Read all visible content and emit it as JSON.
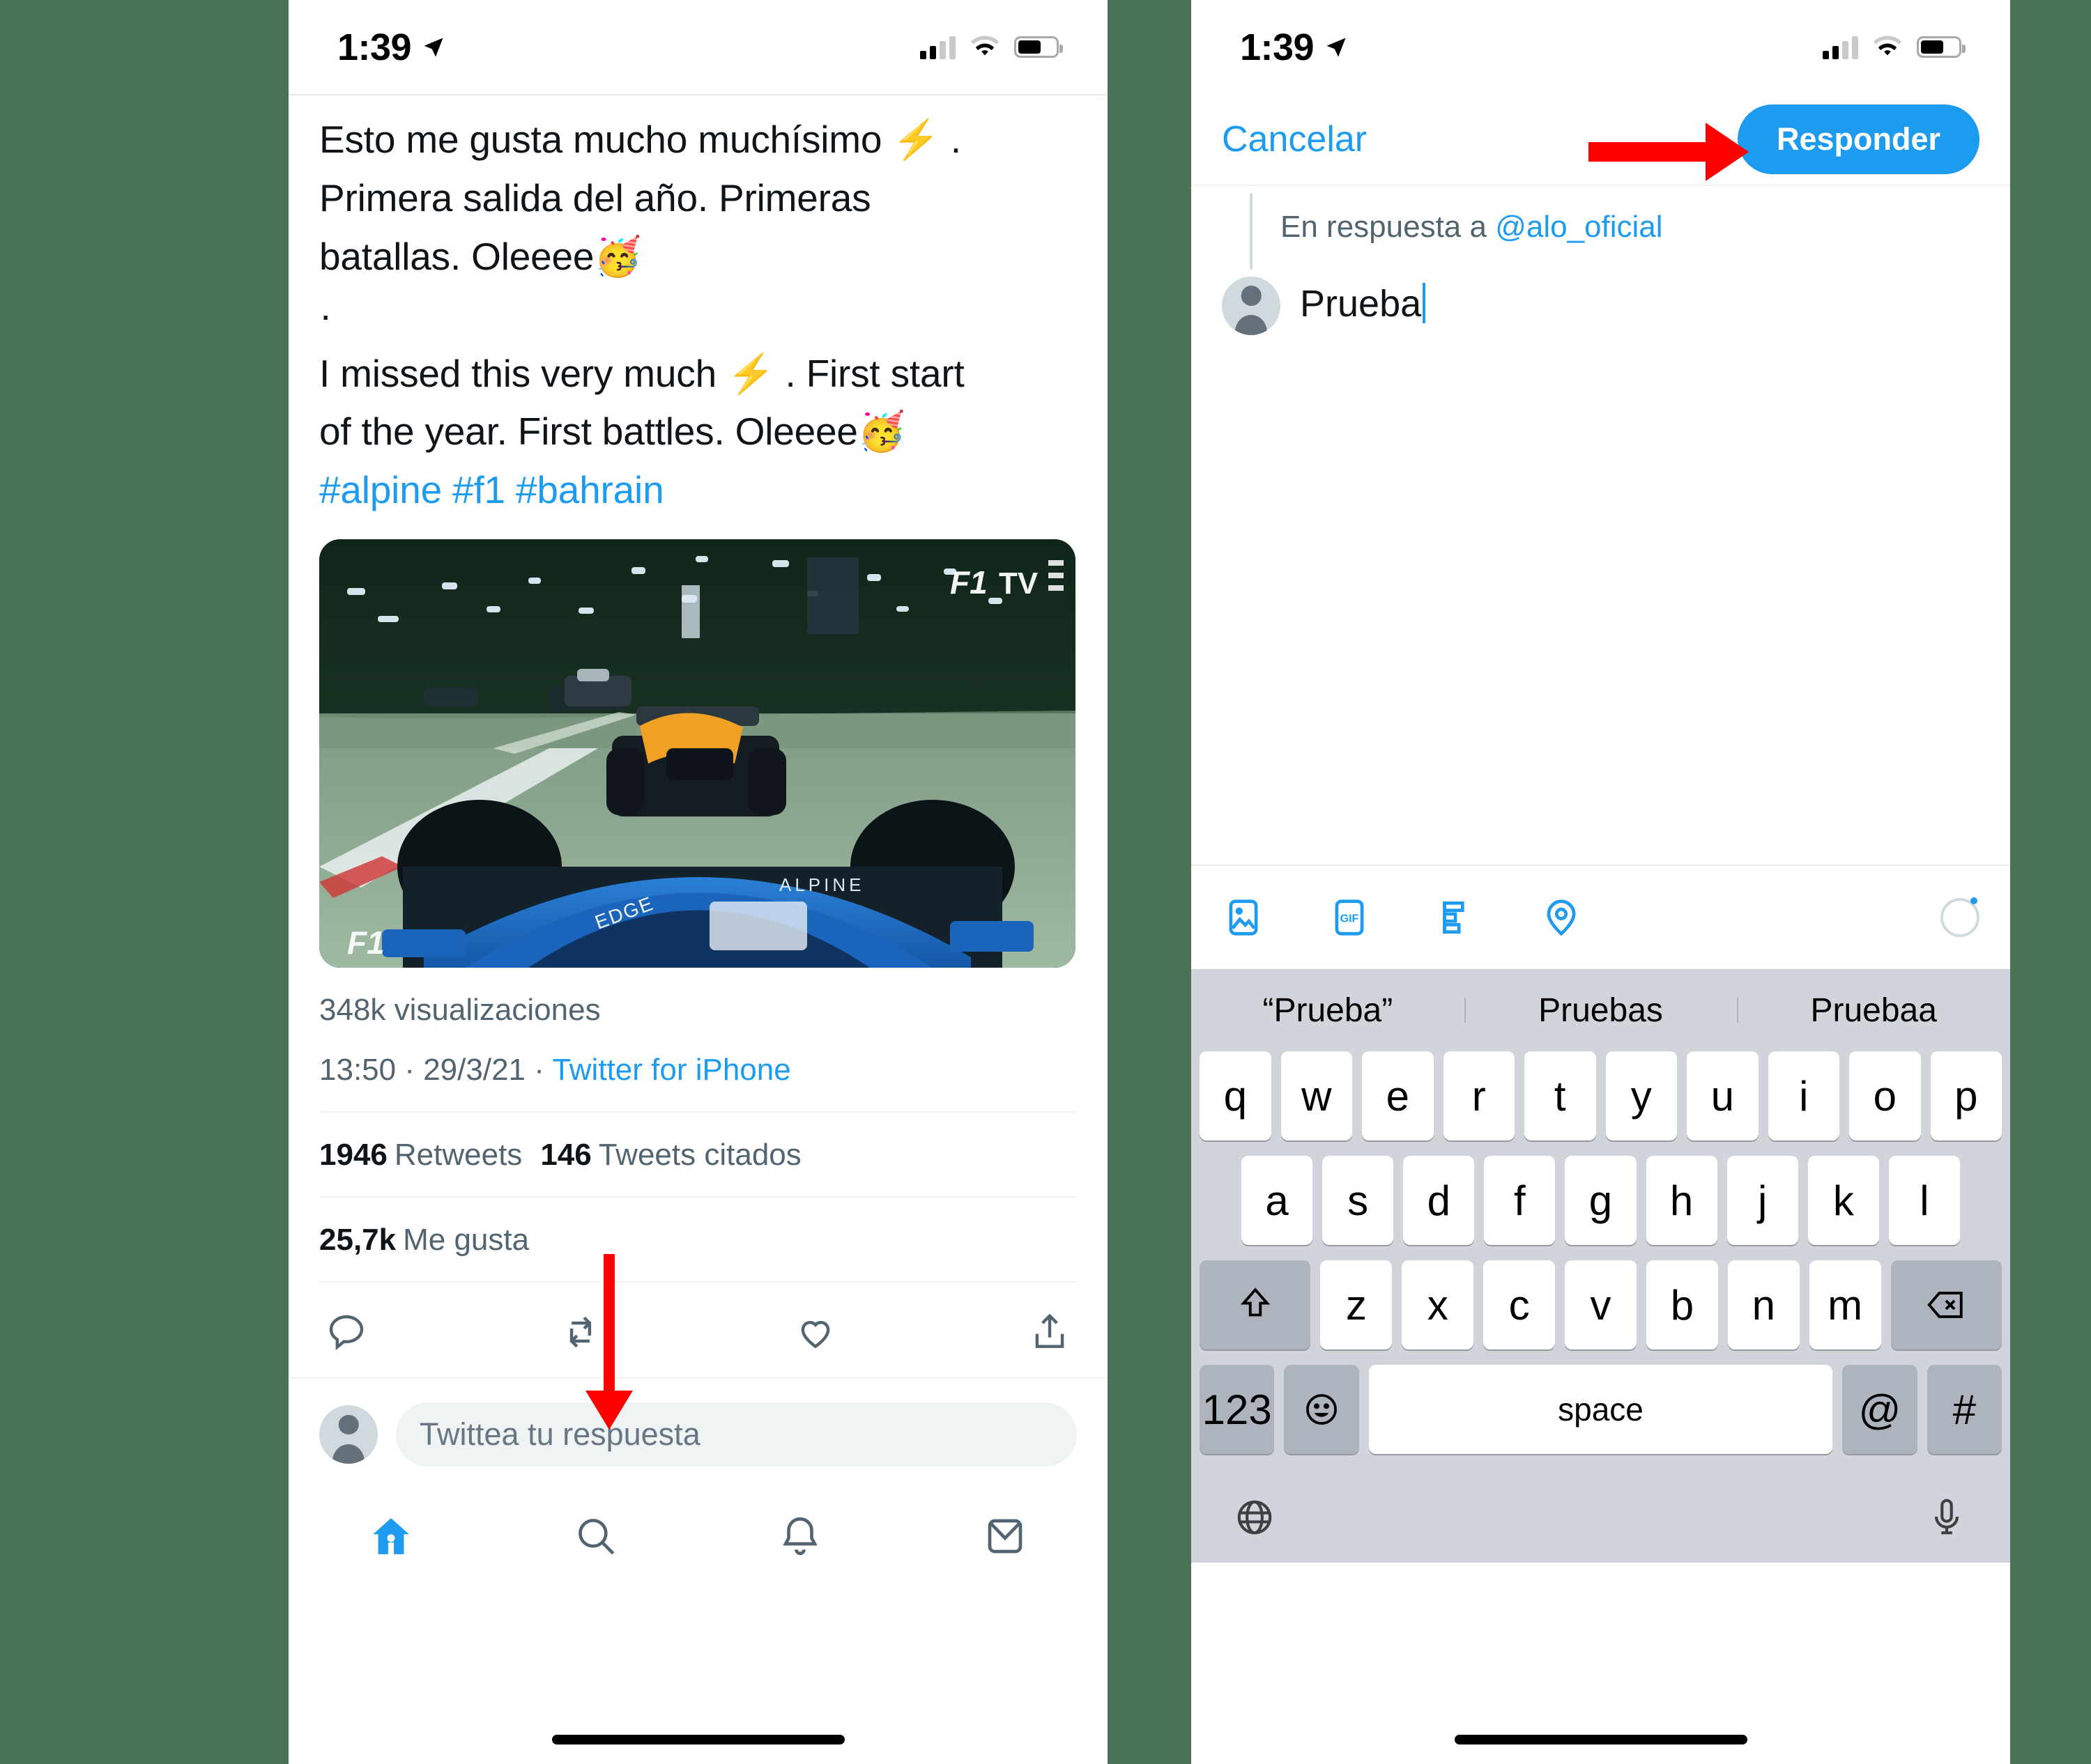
{
  "background_color": "#4a7355",
  "accent_color": "#1d9bf0",
  "annotation_color": "#ff0000",
  "status_bar": {
    "time": "1:39",
    "location_icon": "location-arrow-icon",
    "signal_icon": "cellular-signal-icon",
    "wifi_icon": "wifi-icon",
    "battery_icon": "battery-icon",
    "battery_level_percent": 62
  },
  "left_screen": {
    "tweet": {
      "text_line_1": "Esto me gusta mucho muchísimo ⚡️ .",
      "text_line_2": "Primera salida del año. Primeras",
      "text_line_3": "batallas. Oleeee🥳",
      "separator": "·",
      "text_line_4": "I missed this very much ⚡️ .  First start",
      "text_line_5": "of the year.  First battles.  Oleeee🥳",
      "hashtags": "#alpine #f1 #bahrain",
      "media_label": "f1-onboard-video-thumbnail",
      "media_badge": "F1 TV",
      "views": "348k visualizaciones",
      "timestamp": "13:50 · 29/3/21 · ",
      "source": "Twitter for iPhone",
      "retweets_count": "1946",
      "retweets_label": "Retweets",
      "quotes_count": "146",
      "quotes_label": "Tweets citados",
      "likes_count": "25,7k",
      "likes_label": "Me gusta"
    },
    "actions": [
      {
        "name": "reply-action",
        "icon": "comment-icon"
      },
      {
        "name": "retweet-action",
        "icon": "retweet-icon"
      },
      {
        "name": "like-action",
        "icon": "heart-icon"
      },
      {
        "name": "share-action",
        "icon": "share-icon"
      }
    ],
    "reply_bar": {
      "avatar": "default-avatar",
      "placeholder": "Twittea tu respuesta"
    },
    "tabbar": [
      {
        "name": "tab-home",
        "icon": "home-icon",
        "active": true
      },
      {
        "name": "tab-search",
        "icon": "search-icon",
        "active": false
      },
      {
        "name": "tab-notifications",
        "icon": "bell-icon",
        "active": false
      },
      {
        "name": "tab-messages",
        "icon": "envelope-icon",
        "active": false
      }
    ]
  },
  "right_screen": {
    "cancel_label": "Cancelar",
    "submit_label": "Responder",
    "in_reply_to_prefix": "En respuesta a ",
    "in_reply_to_handle": "@alo_oficial",
    "compose_value": "Prueba",
    "toolbar": [
      {
        "name": "add-image-button",
        "icon": "image-icon"
      },
      {
        "name": "add-gif-button",
        "icon": "gif-icon"
      },
      {
        "name": "add-poll-button",
        "icon": "poll-icon"
      },
      {
        "name": "add-location-button",
        "icon": "location-pin-icon"
      }
    ],
    "char_progress_icon": "character-count-ring",
    "keyboard": {
      "suggestions": [
        "“Prueba”",
        "Pruebas",
        "Pruebaa"
      ],
      "row1": [
        "q",
        "w",
        "e",
        "r",
        "t",
        "y",
        "u",
        "i",
        "o",
        "p"
      ],
      "row2": [
        "a",
        "s",
        "d",
        "f",
        "g",
        "h",
        "j",
        "k",
        "l"
      ],
      "row3_shift": "shift-icon",
      "row3": [
        "z",
        "x",
        "c",
        "v",
        "b",
        "n",
        "m"
      ],
      "row3_backspace": "backspace-icon",
      "numbers_key": "123",
      "emoji_key": "emoji-icon",
      "space_key": "space",
      "at_key": "@",
      "hash_key": "#",
      "globe_key": "globe-icon",
      "mic_key": "microphone-icon"
    }
  },
  "annotations": [
    {
      "name": "arrow-to-reply-action",
      "direction": "down",
      "color": "#ff0000"
    },
    {
      "name": "arrow-to-responder-button",
      "direction": "right",
      "color": "#ff0000"
    }
  ]
}
